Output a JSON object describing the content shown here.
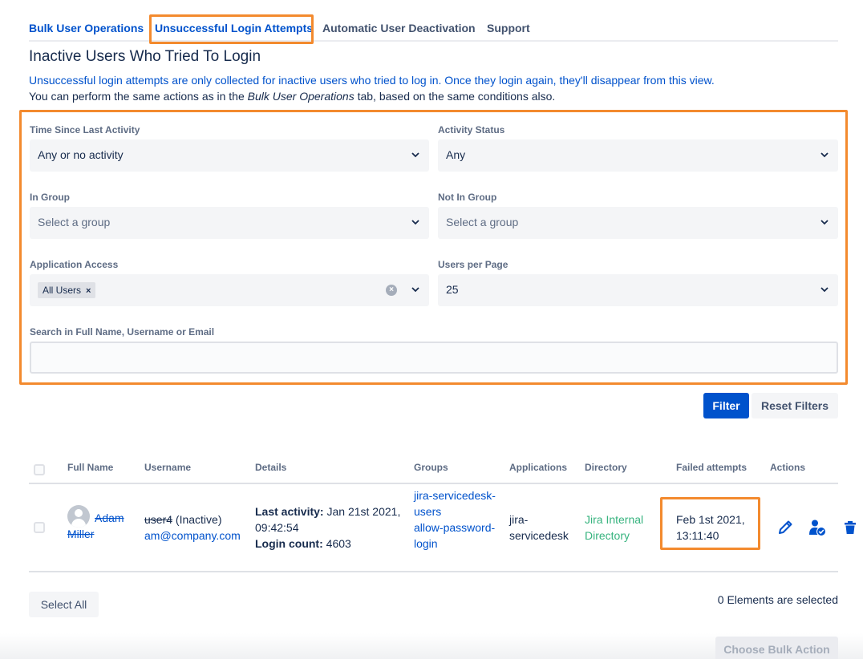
{
  "tabs": [
    {
      "label": "Bulk User Operations"
    },
    {
      "label": "Unsuccessful Login Attempts"
    },
    {
      "label": "Automatic User Deactivation"
    },
    {
      "label": "Support"
    }
  ],
  "title": "Inactive Users Who Tried To Login",
  "info_line1": "Unsuccessful login attempts are only collected for inactive users who tried to log in. Once they login again, they'll disappear from this view.",
  "info_line2_prefix": "You can perform the same actions as in the ",
  "info_line2_emph": "Bulk User Operations",
  "info_line2_suffix": " tab, based on the same conditions also.",
  "filters": {
    "time_since": {
      "label": "Time Since Last Activity",
      "value": "Any or no activity"
    },
    "activity_status": {
      "label": "Activity Status",
      "value": "Any"
    },
    "in_group": {
      "label": "In Group",
      "placeholder": "Select a group"
    },
    "not_in_group": {
      "label": "Not In Group",
      "placeholder": "Select a group"
    },
    "app_access": {
      "label": "Application Access",
      "chip": "All Users",
      "chip_remove": "×"
    },
    "users_per_page": {
      "label": "Users per Page",
      "value": "25"
    },
    "search": {
      "label": "Search in Full Name, Username or Email",
      "value": ""
    }
  },
  "buttons": {
    "filter": "Filter",
    "reset": "Reset Filters",
    "select_all": "Select All",
    "bulk_action": "Choose Bulk Action"
  },
  "table": {
    "headers": [
      "Full Name",
      "Username",
      "Details",
      "Groups",
      "Applications",
      "Directory",
      "Failed attempts",
      "Actions"
    ],
    "rows": [
      {
        "full_name_first": "Adam",
        "full_name_last": "Miller",
        "username": "user4",
        "username_status": " (Inactive)",
        "email": "am@company.com",
        "last_activity_label": "Last activity:",
        "last_activity_value": " Jan 21st 2021, 09:42:54",
        "login_count_label": "Login count:",
        "login_count_value": " 4603",
        "groups": [
          "jira-servicedesk-users",
          "allow-password-login"
        ],
        "application": "jira-servicedesk",
        "directory": "Jira Internal Directory",
        "failed_attempts": "Feb 1st 2021, 13:11:40",
        "actions": [
          "edit-icon",
          "user-check-icon",
          "trash-icon"
        ]
      }
    ]
  },
  "selected_count": "0 Elements are selected",
  "colors": {
    "accent": "#0052cc",
    "highlight": "#f38a2e",
    "directory": "#36b37e"
  }
}
